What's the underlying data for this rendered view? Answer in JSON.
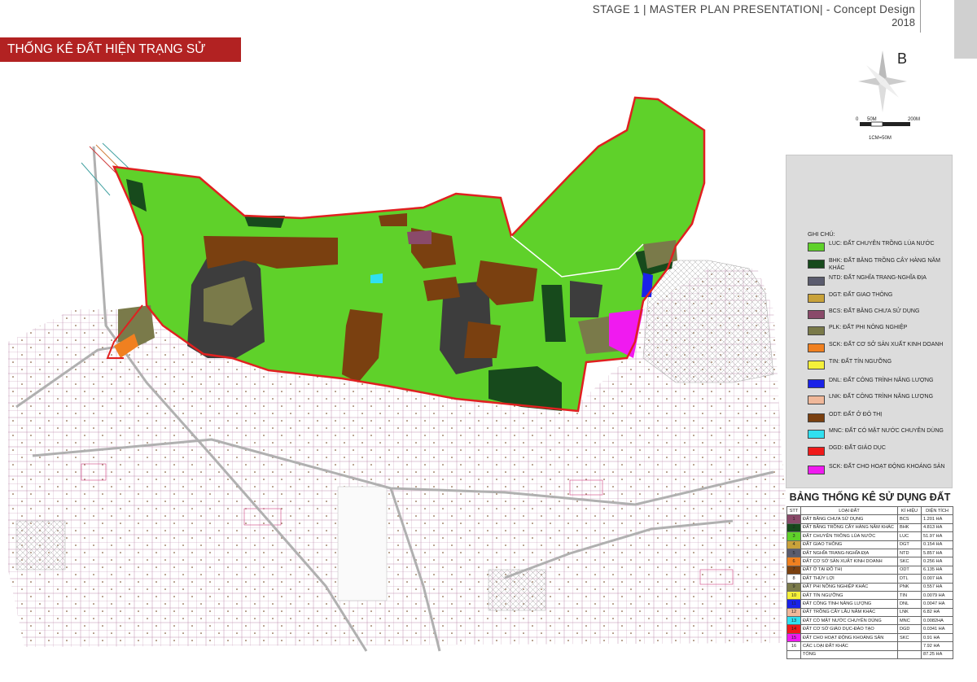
{
  "header": {
    "line1": "STAGE 1 | MASTER PLAN  PRESENTATION| - Concept Design",
    "line2": "2018"
  },
  "title": "THỐNG KÊ ĐẤT HIỆN TRẠNG SỬ DỤNG",
  "compass": {
    "letter": "B",
    "icon": "compass-rose-icon"
  },
  "scale": {
    "zero": "0",
    "mid": "50M",
    "end": "200M",
    "ratio": "1CM=50M"
  },
  "colors": {
    "boundary": "#e02020",
    "paddy": "#5fd12a",
    "forest": "#174a1c",
    "cemetery": "#5b5c6e",
    "transport": "#c9a23a",
    "unused": "#8a4a6a",
    "nonagri": "#7a7a4a",
    "production": "#f08020",
    "religion": "#f5f03a",
    "energy": "#1a22e8",
    "perennial": "#f0b89a",
    "urban": "#7a4010",
    "water": "#30e0f0",
    "education": "#f01a1a",
    "mineral": "#f01af0",
    "dark_plot": "#3d3d3d"
  },
  "legend": {
    "title": "GHI CHÚ:",
    "items": [
      {
        "color": "#5fd12a",
        "label": "LUC: ĐẤT CHUYÊN TRỒNG LÚA NƯỚC"
      },
      {
        "color": "#174a1c",
        "label": "BHK: ĐẤT BẰNG TRỒNG CÂY HÀNG NĂM KHÁC"
      },
      {
        "color": "#5b5c6e",
        "label": "NTD: ĐẤT NGHĨA TRANG-NGHĨA ĐỊA"
      },
      {
        "color": "#c9a23a",
        "label": "DGT: ĐẤT GIAO THÔNG"
      },
      {
        "color": "#8a4a6a",
        "label": "BCS: ĐẤT BẰNG CHƯA SỬ DỤNG"
      },
      {
        "color": "#7a7a4a",
        "label": "PLK: ĐẤT PHI NÔNG NGHIỆP"
      },
      {
        "color": "#f08020",
        "label": "SCK: ĐẤT CƠ SỞ SẢN XUẤT KINH DOANH"
      },
      {
        "color": "#f5f03a",
        "label": "TIN: ĐẤT TÍN NGƯỠNG"
      },
      {
        "color": "#1a22e8",
        "label": "DNL: ĐẤT CÔNG TRÌNH NĂNG LƯỢNG"
      },
      {
        "color": "#f0b89a",
        "label": "LNK: ĐẤT CÔNG TRÌNH NĂNG LƯỢNG"
      },
      {
        "color": "#7a4010",
        "label": "ODT: ĐẤT Ở ĐÔ THỊ"
      },
      {
        "color": "#30e0f0",
        "label": "MNC: ĐẤT CÓ MẶT NƯỚC CHUYÊN DÙNG"
      },
      {
        "color": "#f01a1a",
        "label": "DGD: ĐẤT GIÁO DỤC"
      },
      {
        "color": "#f01af0",
        "label": "SCK: ĐẤT CHO HOẠT ĐỘNG KHOÁNG SẢN"
      }
    ]
  },
  "table": {
    "title": "BẢNG THỐNG KÊ SỬ DỤNG ĐẤT",
    "headers": [
      "STT",
      "LOẠI ĐẤT",
      "KÍ HIỆU",
      "DIỆN TÍCH"
    ],
    "rows": [
      {
        "stt": "1",
        "color": "#8a4a6a",
        "name": "ĐẤT BẰNG CHƯA SỬ DỤNG",
        "code": "BCS",
        "area": "1.201 HA"
      },
      {
        "stt": "2",
        "color": "#174a1c",
        "name": "ĐẤT BẰNG TRỒNG CÂY HÀNG NĂM KHÁC",
        "code": "BHK",
        "area": "4.813 HA"
      },
      {
        "stt": "3",
        "color": "#5fd12a",
        "name": "ĐẤT CHUYÊN TRỒNG LÚA NƯỚC",
        "code": "LUC",
        "area": "51.97 HA"
      },
      {
        "stt": "4",
        "color": "#c9a23a",
        "name": "ĐẤT GIAO THÔNG",
        "code": "DGT",
        "area": "0.154 HA"
      },
      {
        "stt": "5",
        "color": "#5b5c6e",
        "name": "ĐẤT NGHĨA TRANG-NGHĨA ĐỊA",
        "code": "NTD",
        "area": "5.857 HA"
      },
      {
        "stt": "6",
        "color": "#f08020",
        "name": "ĐẤT CƠ SỞ SẢN XUẤT KINH DOANH",
        "code": "SKC",
        "area": "0.256 HA"
      },
      {
        "stt": "7",
        "color": "#7a4010",
        "name": "ĐẤT Ở TẠI ĐÔ THỊ",
        "code": "ODT",
        "area": "6.135 HA"
      },
      {
        "stt": "8",
        "color": "#ffffff",
        "name": "ĐẤT THỦY LỢI",
        "code": "DTL",
        "area": "0.007 HA"
      },
      {
        "stt": "9",
        "color": "#7a7a4a",
        "name": "ĐẤT PHI NÔNG NGHIỆP KHÁC",
        "code": "PNK",
        "area": "0.557 HA"
      },
      {
        "stt": "10",
        "color": "#f5f03a",
        "name": "ĐẤT TÍN NGƯỠNG",
        "code": "TIN",
        "area": "0.0079 HA"
      },
      {
        "stt": "11",
        "color": "#1a22e8",
        "name": "ĐẤT CÔNG TÌNH NĂNG LƯỢNG",
        "code": "DNL",
        "area": "0.0047 HA"
      },
      {
        "stt": "12",
        "color": "#f0b89a",
        "name": "ĐẤT TRỒNG CÂY LÂU NĂM KHÁC",
        "code": "LNK",
        "area": "6.82 HA"
      },
      {
        "stt": "13",
        "color": "#30e0f0",
        "name": "ĐẤT CÓ MẶT NƯỚC CHUYÊN DÙNG",
        "code": "MNC",
        "area": "0.0082HA"
      },
      {
        "stt": "14",
        "color": "#f01a1a",
        "name": "ĐẤT CƠ SỞ GIÁO DỤC-ĐÀO TẠO",
        "code": "DGD",
        "area": "0.0341 HA"
      },
      {
        "stt": "15",
        "color": "#f01af0",
        "name": "ĐẤT CHO HOẠT ĐỘNG KHOÁNG SẢN",
        "code": "SKC",
        "area": "0.91 HA"
      },
      {
        "stt": "16",
        "color": "#ffffff",
        "name": "CÁC LOẠI ĐẤT KHÁC",
        "code": "",
        "area": "7.92 HA"
      }
    ],
    "total_label": "TỔNG",
    "total_value": "87.25 HA"
  }
}
